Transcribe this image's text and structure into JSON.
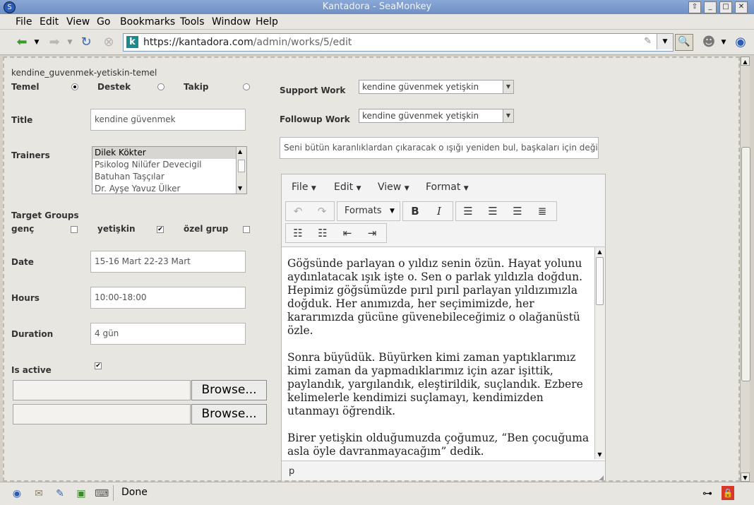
{
  "window": {
    "title": "Kantadora - SeaMonkey"
  },
  "menu": [
    "File",
    "Edit",
    "View",
    "Go",
    "Bookmarks",
    "Tools",
    "Window",
    "Help"
  ],
  "url": {
    "host": "https://kantadora.com",
    "path": "/admin/works/5/edit"
  },
  "form": {
    "slug": "kendine_guvenmek-yetiskin-temel",
    "level": {
      "temel": "Temel",
      "destek": "Destek",
      "takip": "Takip",
      "selected": "temel"
    },
    "title": {
      "label": "Title",
      "value": "kendine güvenmek"
    },
    "trainers": {
      "label": "Trainers",
      "options": [
        "Dilek Kökter",
        "Psikolog Nilüfer Devecigil",
        "Batuhan Taşçılar",
        "Dr. Ayşe Yavuz Ülker"
      ],
      "selected": "Dilek Kökter"
    },
    "target_groups": {
      "label": "Target Groups",
      "items": [
        {
          "label": "genç",
          "checked": false
        },
        {
          "label": "yetişkin",
          "checked": true
        },
        {
          "label": "özel grup",
          "checked": false
        }
      ]
    },
    "date": {
      "label": "Date",
      "value": "15-16 Mart 22-23 Mart"
    },
    "hours": {
      "label": "Hours",
      "value": "10:00-18:00"
    },
    "duration": {
      "label": "Duration",
      "value": "4 gün"
    },
    "is_active": {
      "label": "Is active",
      "checked": true
    },
    "browse_label": "Browse...",
    "support_work": {
      "label": "Support Work",
      "value": "kendine güvenmek yetişkin"
    },
    "followup_work": {
      "label": "Followup Work",
      "value": "kendine güvenmek yetişkin"
    },
    "summary": "Seni bütün karanlıklardan çıkaracak o ışığı yeniden bul, başkaları için değil k"
  },
  "editor": {
    "menus": [
      "File",
      "Edit",
      "View",
      "Format"
    ],
    "formats_label": "Formats",
    "paragraphs": [
      "Göğsünde parlayan o yıldız senin özün. Hayat yolunu aydınlatacak ışık işte o. Sen o parlak yıldızla doğdun. Hepimiz göğsümüzde pırıl pırıl parlayan yıldızımızla doğduk. Her anımızda, her seçimimizde, her kararımızda gücüne güvenebileceğimiz o olağanüstü özle.",
      "Sonra büyüdük. Büyürken kimi zaman yaptıklarımız kimi zaman da yapmadıklarımız için azar işittik, paylandık, yargılandık, eleştirildik, suçlandık. Ezbere kelimelerle kendimizi suçlamayı, kendimizden utanmayı öğrendik.",
      "Birer yetişkin olduğumuzda çoğumuz, “Ben çocuğuma asla öyle davranmayacağım” dedik."
    ],
    "path": "p"
  },
  "status": {
    "text": "Done"
  }
}
